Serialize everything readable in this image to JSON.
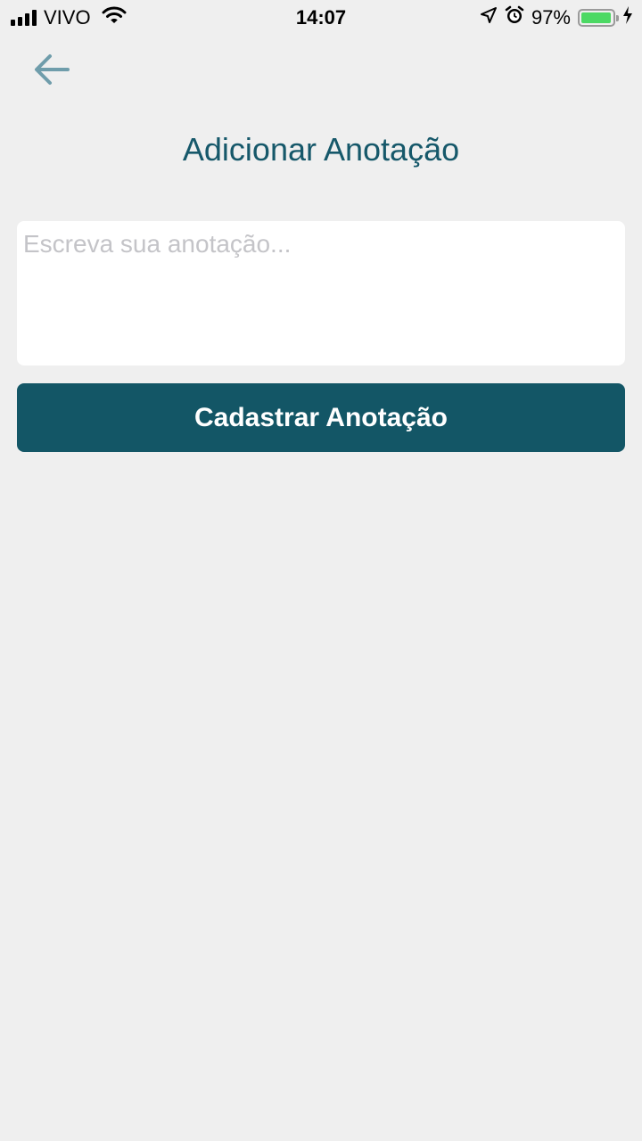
{
  "status_bar": {
    "carrier": "VIVO",
    "time": "14:07",
    "battery_percent": "97%",
    "battery_level": 0.97,
    "icons": [
      "signal-icon",
      "wifi-icon",
      "location-icon",
      "alarm-icon",
      "battery-icon",
      "charging-icon"
    ]
  },
  "nav": {
    "back_icon": "arrow-left-icon"
  },
  "page": {
    "title": "Adicionar Anotação"
  },
  "form": {
    "note_placeholder": "Escreva sua anotação...",
    "note_value": "",
    "submit_label": "Cadastrar Anotação"
  },
  "colors": {
    "background": "#efefef",
    "title": "#16586a",
    "button": "#135666",
    "back_arrow": "#6f9dab",
    "battery": "#4cd964"
  }
}
